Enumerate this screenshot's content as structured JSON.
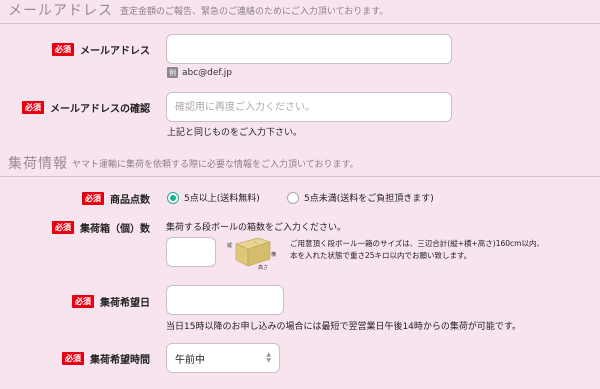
{
  "email_section": {
    "title": "メールアドレス",
    "desc": "査定金額のご報告、緊急のご連絡のためにご入力頂いております。"
  },
  "email": {
    "required": "必須",
    "label": "メールアドレス",
    "value": "",
    "example_badge": "例",
    "example": "abc@def.jp"
  },
  "email_confirm": {
    "required": "必須",
    "label": "メールアドレスの確認",
    "placeholder": "確認用に再度ご入力ください。",
    "hint": "上記と同じものをご入力下さい。"
  },
  "pickup_section": {
    "title": "集荷情報",
    "desc": "ヤマト運輸に集荷を依頼する際に必要な情報をご入力頂いております。"
  },
  "item_count": {
    "required": "必須",
    "label": "商品点数",
    "options": [
      "5点以上(送料無料)",
      "5点未満(送料をご負担頂きます)"
    ],
    "selected_index": 0
  },
  "box_count": {
    "required": "必須",
    "label": "集荷箱（個）数",
    "hint": "集荷する段ボールの箱数をご入力ください。",
    "value": "",
    "diagram_labels": {
      "height": "縦",
      "width": "横",
      "depth": "高さ"
    },
    "note_line1": "ご用意頂く段ボール一箱のサイズは、三辺合計(縦+横+高さ)160cm以内、",
    "note_line2": "本を入れた状態で重さ25キロ以内でお願い致します。"
  },
  "pickup_date": {
    "required": "必須",
    "label": "集荷希望日",
    "value": "",
    "hint": "当日15時以降のお申し込みの場合には最短で翌営業日午後14時からの集荷が可能です。"
  },
  "pickup_time": {
    "required": "必須",
    "label": "集荷希望時間",
    "selected": "午前中"
  },
  "colors": {
    "background": "#f8e4ee",
    "required_badge": "#e60012",
    "radio_accent": "#1fae98"
  }
}
